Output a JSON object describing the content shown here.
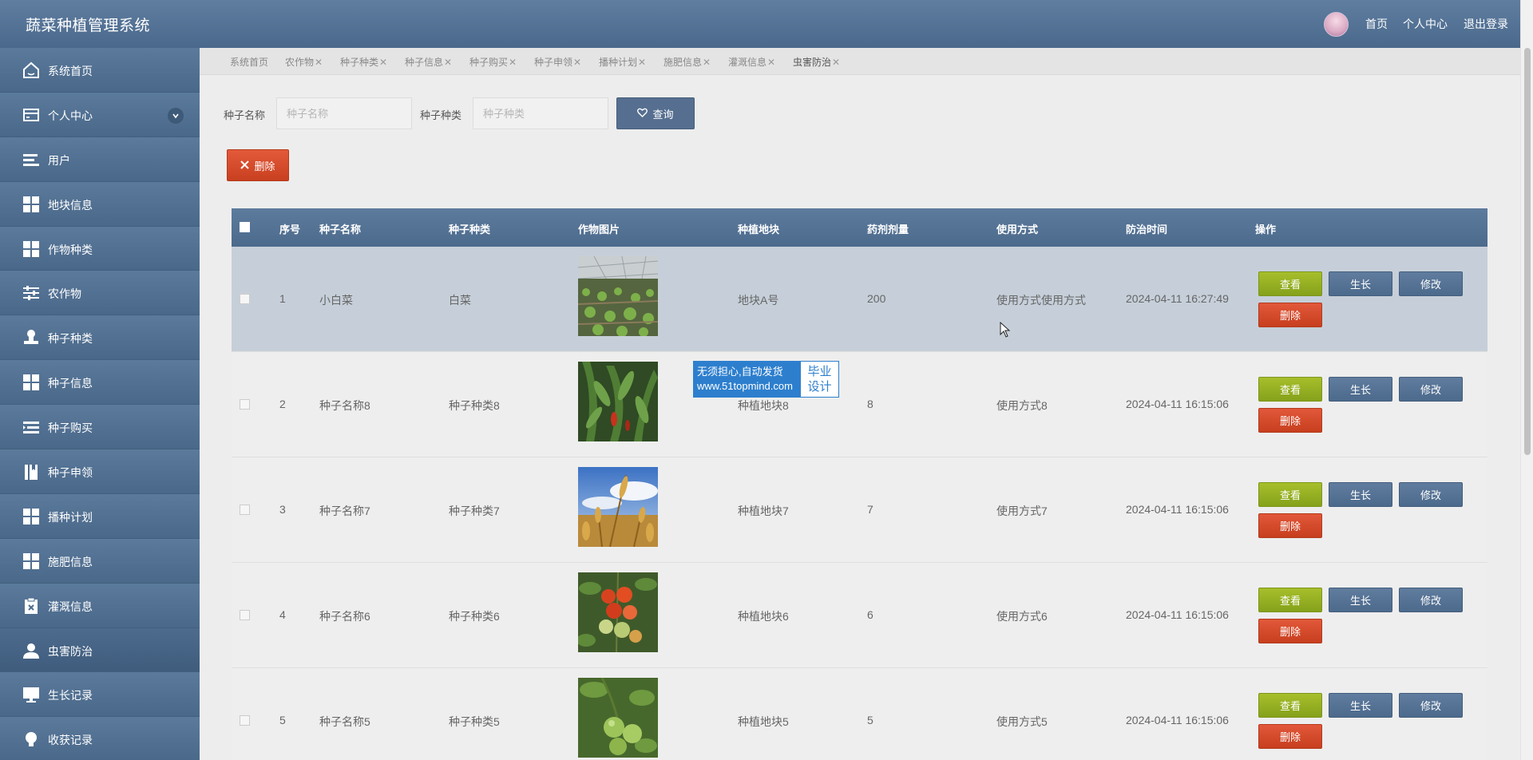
{
  "header": {
    "title": "蔬菜种植管理系统",
    "links": [
      "首页",
      "个人中心",
      "退出登录"
    ]
  },
  "sidebar": {
    "items": [
      {
        "label": "系统首页",
        "icon": "home-icon"
      },
      {
        "label": "个人中心",
        "icon": "card-icon"
      },
      {
        "label": "用户",
        "icon": "list-icon"
      },
      {
        "label": "地块信息",
        "icon": "grid-icon"
      },
      {
        "label": "作物种类",
        "icon": "grid-icon"
      },
      {
        "label": "农作物",
        "icon": "sliders-icon"
      },
      {
        "label": "种子种类",
        "icon": "stamp-icon"
      },
      {
        "label": "种子信息",
        "icon": "grid-icon"
      },
      {
        "label": "种子购买",
        "icon": "list-indent-icon"
      },
      {
        "label": "种子申领",
        "icon": "book-icon"
      },
      {
        "label": "播种计划",
        "icon": "grid-icon"
      },
      {
        "label": "施肥信息",
        "icon": "grid-icon"
      },
      {
        "label": "灌溉信息",
        "icon": "clipboard-x-icon"
      },
      {
        "label": "虫害防治",
        "icon": "user-icon"
      },
      {
        "label": "生长记录",
        "icon": "monitor-icon"
      },
      {
        "label": "收获记录",
        "icon": "bulb-icon"
      }
    ]
  },
  "tabs": [
    "系统首页",
    "农作物",
    "种子种类",
    "种子信息",
    "种子购买",
    "种子申领",
    "播种计划",
    "施肥信息",
    "灌溉信息",
    "虫害防治"
  ],
  "tab_close": "✕",
  "search": {
    "name_label": "种子名称",
    "name_placeholder": "种子名称",
    "type_label": "种子种类",
    "type_placeholder": "种子种类",
    "button": "查询"
  },
  "toolbar": {
    "delete_label": "删除"
  },
  "table": {
    "headers": [
      "序号",
      "种子名称",
      "种子种类",
      "作物图片",
      "种植地块",
      "药剂剂量",
      "使用方式",
      "防治时间",
      "操作"
    ],
    "actions": {
      "view": "查看",
      "grow": "生长",
      "edit": "修改",
      "delete": "删除"
    },
    "rows": [
      {
        "no": "1",
        "name": "小白菜",
        "type": "白菜",
        "image": "greenhouse-seedlings",
        "plot": "地块A号",
        "dose": "200",
        "method": "使用方式使用方式",
        "time": "2024-04-11 16:27:49"
      },
      {
        "no": "2",
        "name": "种子名称8",
        "type": "种子种类8",
        "image": "pepper-plant",
        "plot": "种植地块8",
        "dose": "8",
        "method": "使用方式8",
        "time": "2024-04-11 16:15:06"
      },
      {
        "no": "3",
        "name": "种子名称7",
        "type": "种子种类7",
        "image": "wheat-sky",
        "plot": "种植地块7",
        "dose": "7",
        "method": "使用方式7",
        "time": "2024-04-11 16:15:06"
      },
      {
        "no": "4",
        "name": "种子名称6",
        "type": "种子种类6",
        "image": "tomato-cluster",
        "plot": "种植地块6",
        "dose": "6",
        "method": "使用方式6",
        "time": "2024-04-11 16:15:06"
      },
      {
        "no": "5",
        "name": "种子名称5",
        "type": "种子种类5",
        "image": "green-tomato",
        "plot": "种植地块5",
        "dose": "5",
        "method": "使用方式5",
        "time": "2024-04-11 16:15:06"
      }
    ]
  },
  "watermark": {
    "line1": "无须担心,自动发货",
    "line2": "www.51topmind.com",
    "right1": "毕业",
    "right2": "设计"
  },
  "colors": {
    "header": "#5f7ea0",
    "sidebar": "#4d6b8e",
    "view_button": "#a7bf2b",
    "blue_button": "#566f90",
    "delete_button": "#d94c2c",
    "highlight_row": "#c6cfd9"
  }
}
